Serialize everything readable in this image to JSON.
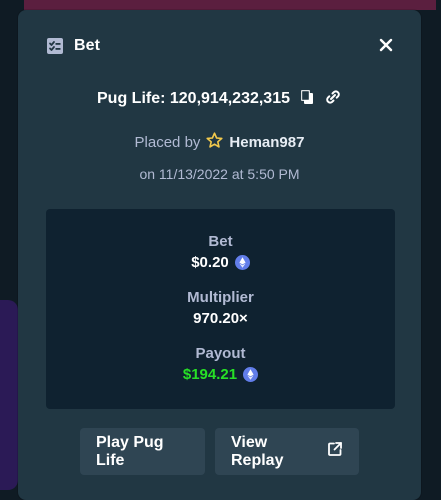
{
  "modal": {
    "title": "Bet",
    "game_line_text": "Pug Life: 120,914,232,315",
    "placed_by_prefix": "Placed by",
    "placed_by_user": "Heman987",
    "placed_on": "on 11/13/2022 at 5:50 PM"
  },
  "stats": {
    "bet_label": "Bet",
    "bet_value": "$0.20",
    "multiplier_label": "Multiplier",
    "multiplier_value": "970.20×",
    "payout_label": "Payout",
    "payout_value": "$194.21"
  },
  "actions": {
    "play_label": "Play Pug Life",
    "replay_label": "View Replay"
  },
  "icons": {
    "header_icon": "bet-slip-icon",
    "close_icon": "close-icon",
    "copy_icon": "copy-icon",
    "link_icon": "link-icon",
    "star_icon": "star-icon",
    "currency_icon": "ethereum-icon",
    "external_link_icon": "external-link-icon"
  },
  "colors": {
    "modal_bg": "#213743",
    "panel_bg": "#0f2230",
    "text_primary": "#ffffff",
    "text_secondary": "#b1bad3",
    "payout_green": "#27e026",
    "button_bg": "#2f4553",
    "star_yellow": "#f2c94c",
    "eth_blue": "#627eea"
  }
}
